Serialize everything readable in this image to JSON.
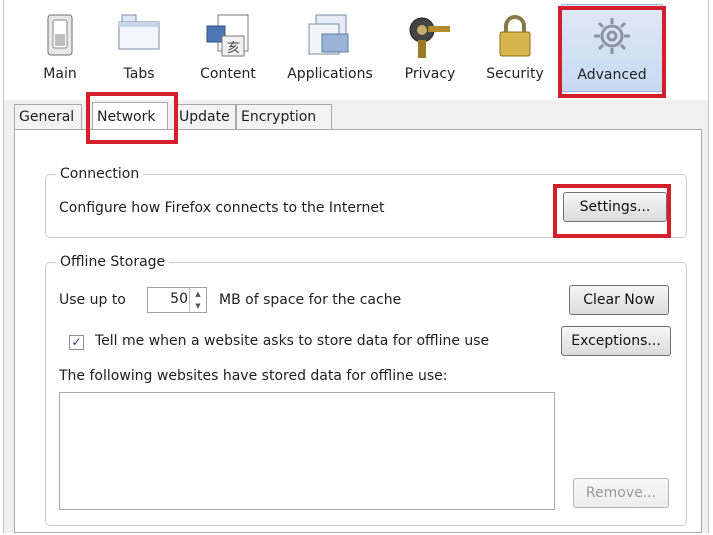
{
  "toolbar": {
    "items": [
      {
        "label": "Main"
      },
      {
        "label": "Tabs"
      },
      {
        "label": "Content"
      },
      {
        "label": "Applications"
      },
      {
        "label": "Privacy"
      },
      {
        "label": "Security"
      },
      {
        "label": "Advanced",
        "selected": true
      }
    ]
  },
  "tabs": [
    {
      "label": "General"
    },
    {
      "label": "Network",
      "active": true
    },
    {
      "label": "Update"
    },
    {
      "label": "Encryption"
    }
  ],
  "connection": {
    "legend": "Connection",
    "description": "Configure how Firefox connects to the Internet",
    "settings_label": "Settings..."
  },
  "offline": {
    "legend": "Offline Storage",
    "use_up_to_label": "Use up to",
    "cache_value": "50",
    "cache_unit_label": "MB of space for the cache",
    "clear_now_label": "Clear Now",
    "tell_me_label": "Tell me when a website asks to store data for offline use",
    "tell_me_checked": true,
    "exceptions_label": "Exceptions...",
    "stored_label": "The following websites have stored data for offline use:",
    "remove_label": "Remove..."
  },
  "colors": {
    "highlight": "#d21f2b",
    "selected_bg": "#c7d9f2"
  }
}
